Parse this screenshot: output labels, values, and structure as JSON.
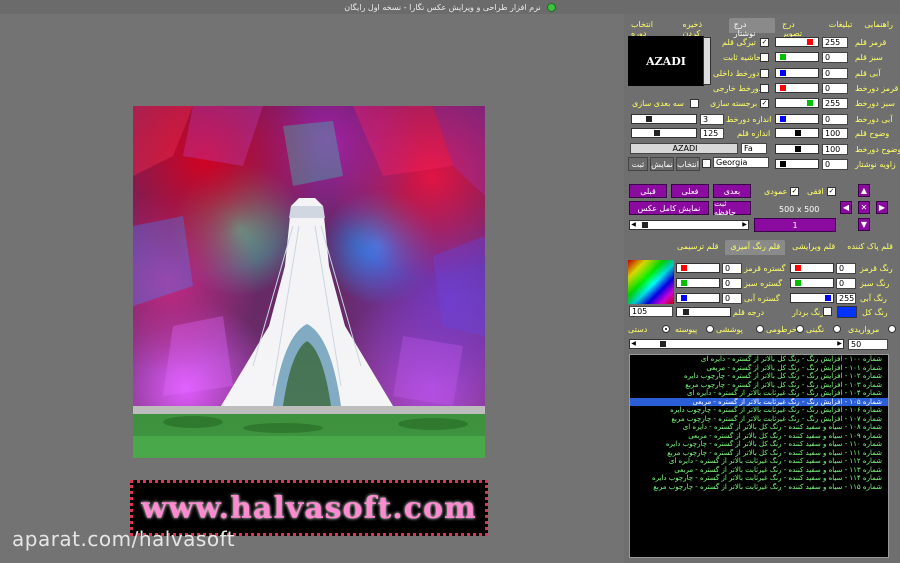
{
  "window": {
    "title": "نرم افزار طراحی و ویرایش عکس نگارا - نسخه اول رایگان"
  },
  "tabs_top": [
    "راهنمایی",
    "تبلیغات",
    "درج تصویر",
    "درج نوشتار",
    "ذخیره کردن",
    "انتخاب دوره"
  ],
  "preview": {
    "banner_text": "www.halvasoft.com"
  },
  "watermark": "aparat.com/halvasoft",
  "text_panel": {
    "preview_text": "AZADI",
    "labels": [
      "قرمز قلم",
      "سبز قلم",
      "آبی قلم",
      "قرمز دورخط",
      "سبز دورخط",
      "آبی دورخط",
      "وضوح قلم",
      "وضوح دورخط",
      "زاویه نوشتار"
    ],
    "values": [
      "255",
      "0",
      "0",
      "0",
      "255",
      "0",
      "100",
      "100",
      "0"
    ],
    "options": [
      "تیرگی قلم",
      "حاشیه ثابت",
      "دورخط داخلی",
      "دورخط خارجی",
      "برجسته سازی",
      "سه بعدی سازی"
    ],
    "outline_size_label": "اندازه دورخط",
    "outline_size": "3",
    "pen_size_label": "اندازه قلم",
    "pen_size": "125",
    "text_input": "AZADI",
    "lang": "Fa",
    "font": "Georgia",
    "select_label": "انتخاب",
    "show_label": "نمایش",
    "save_label": "ثبت"
  },
  "nav": {
    "horizontal": "افقی",
    "vertical": "عمودی",
    "next": "بعدی",
    "current": "فعلی",
    "prev": "قبلی",
    "dims": "500 x 500",
    "save_memory": "ثبت حافظه",
    "full_view": "نمایش کامل عکس",
    "counter": "1"
  },
  "brush_tabs": [
    "قلم پاک کننده",
    "قلم ویرایشی",
    "قلم رنگ آمیزی",
    "قلم ترسیمی"
  ],
  "brush": {
    "left_labels": [
      "رنگ قرمز",
      "رنگ سبز",
      "رنگ آبی"
    ],
    "left_values": [
      "0",
      "0",
      "255"
    ],
    "mid_labels": [
      "گستره قرمز",
      "گستره سبز",
      "گستره آبی"
    ],
    "mid_values": [
      "0",
      "0",
      "0"
    ],
    "color_label": "رنگ کل",
    "picker_label": "رنگ بردار",
    "pen_degree_label": "درجه قلم",
    "pen_degree": "105",
    "radios": [
      "مرواریدی",
      "نگینی",
      "خرطومی",
      "پوششی",
      "پیوسته",
      "دستی"
    ],
    "strength": "50",
    "colors": {
      "blue": "#0033ff",
      "purple": "#8b0aa0",
      "selection": "#2a5fd8",
      "list_text": "#7dff7d"
    }
  },
  "effects_list": [
    "شماره ۱۰۰ - افزایش رنگ - رنگ کل بالاتر از گستره - دایره ای",
    "شماره ۱۰۱ - افزایش رنگ - رنگ کل بالاتر از گستره - مربعی",
    "شماره ۱۰۲ - افزایش رنگ - رنگ کل بالاتر از گستره - چارچوب دایره",
    "شماره ۱۰۳ - افزایش رنگ - رنگ کل بالاتر از گستره - چارچوب مربع",
    "شماره ۱۰۴ - افزایش رنگ - رنگ غیرثابت بالاتر از گستره - دایره ای",
    "شماره ۱۰۵ - افزایش رنگ - رنگ غیرثابت بالاتر از گستره - مربعی",
    "شماره ۱۰۶ - افزایش رنگ - رنگ غیرثابت بالاتر از گستره - چارچوب دایره",
    "شماره ۱۰۷ - افزایش رنگ - رنگ غیرثابت بالاتر از گستره - چارچوب مربع",
    "شماره ۱۰۸ - سیاه و سفید کننده - رنگ کل بالاتر از گستره - دایره ای",
    "شماره ۱۰۹ - سیاه و سفید کننده - رنگ کل بالاتر از گستره - مربعی",
    "شماره ۱۱۰ - سیاه و سفید کننده - رنگ کل بالاتر از گستره - چارچوب دایره",
    "شماره ۱۱۱ - سیاه و سفید کننده - رنگ کل بالاتر از گستره - چارچوب مربع",
    "شماره ۱۱۲ - سیاه و سفید کننده - رنگ غیرثابت بالاتر از گستره - دایره ای",
    "شماره ۱۱۳ - سیاه و سفید کننده - رنگ غیرثابت بالاتر از گستره - مربعی",
    "شماره ۱۱۴ - سیاه و سفید کننده - رنگ غیرثابت بالاتر از گستره - چارچوب دایره",
    "شماره ۱۱۵ - سیاه و سفید کننده - رنگ غیرثابت بالاتر از گستره - چارچوب مربع"
  ],
  "selected_effect_index": 5
}
